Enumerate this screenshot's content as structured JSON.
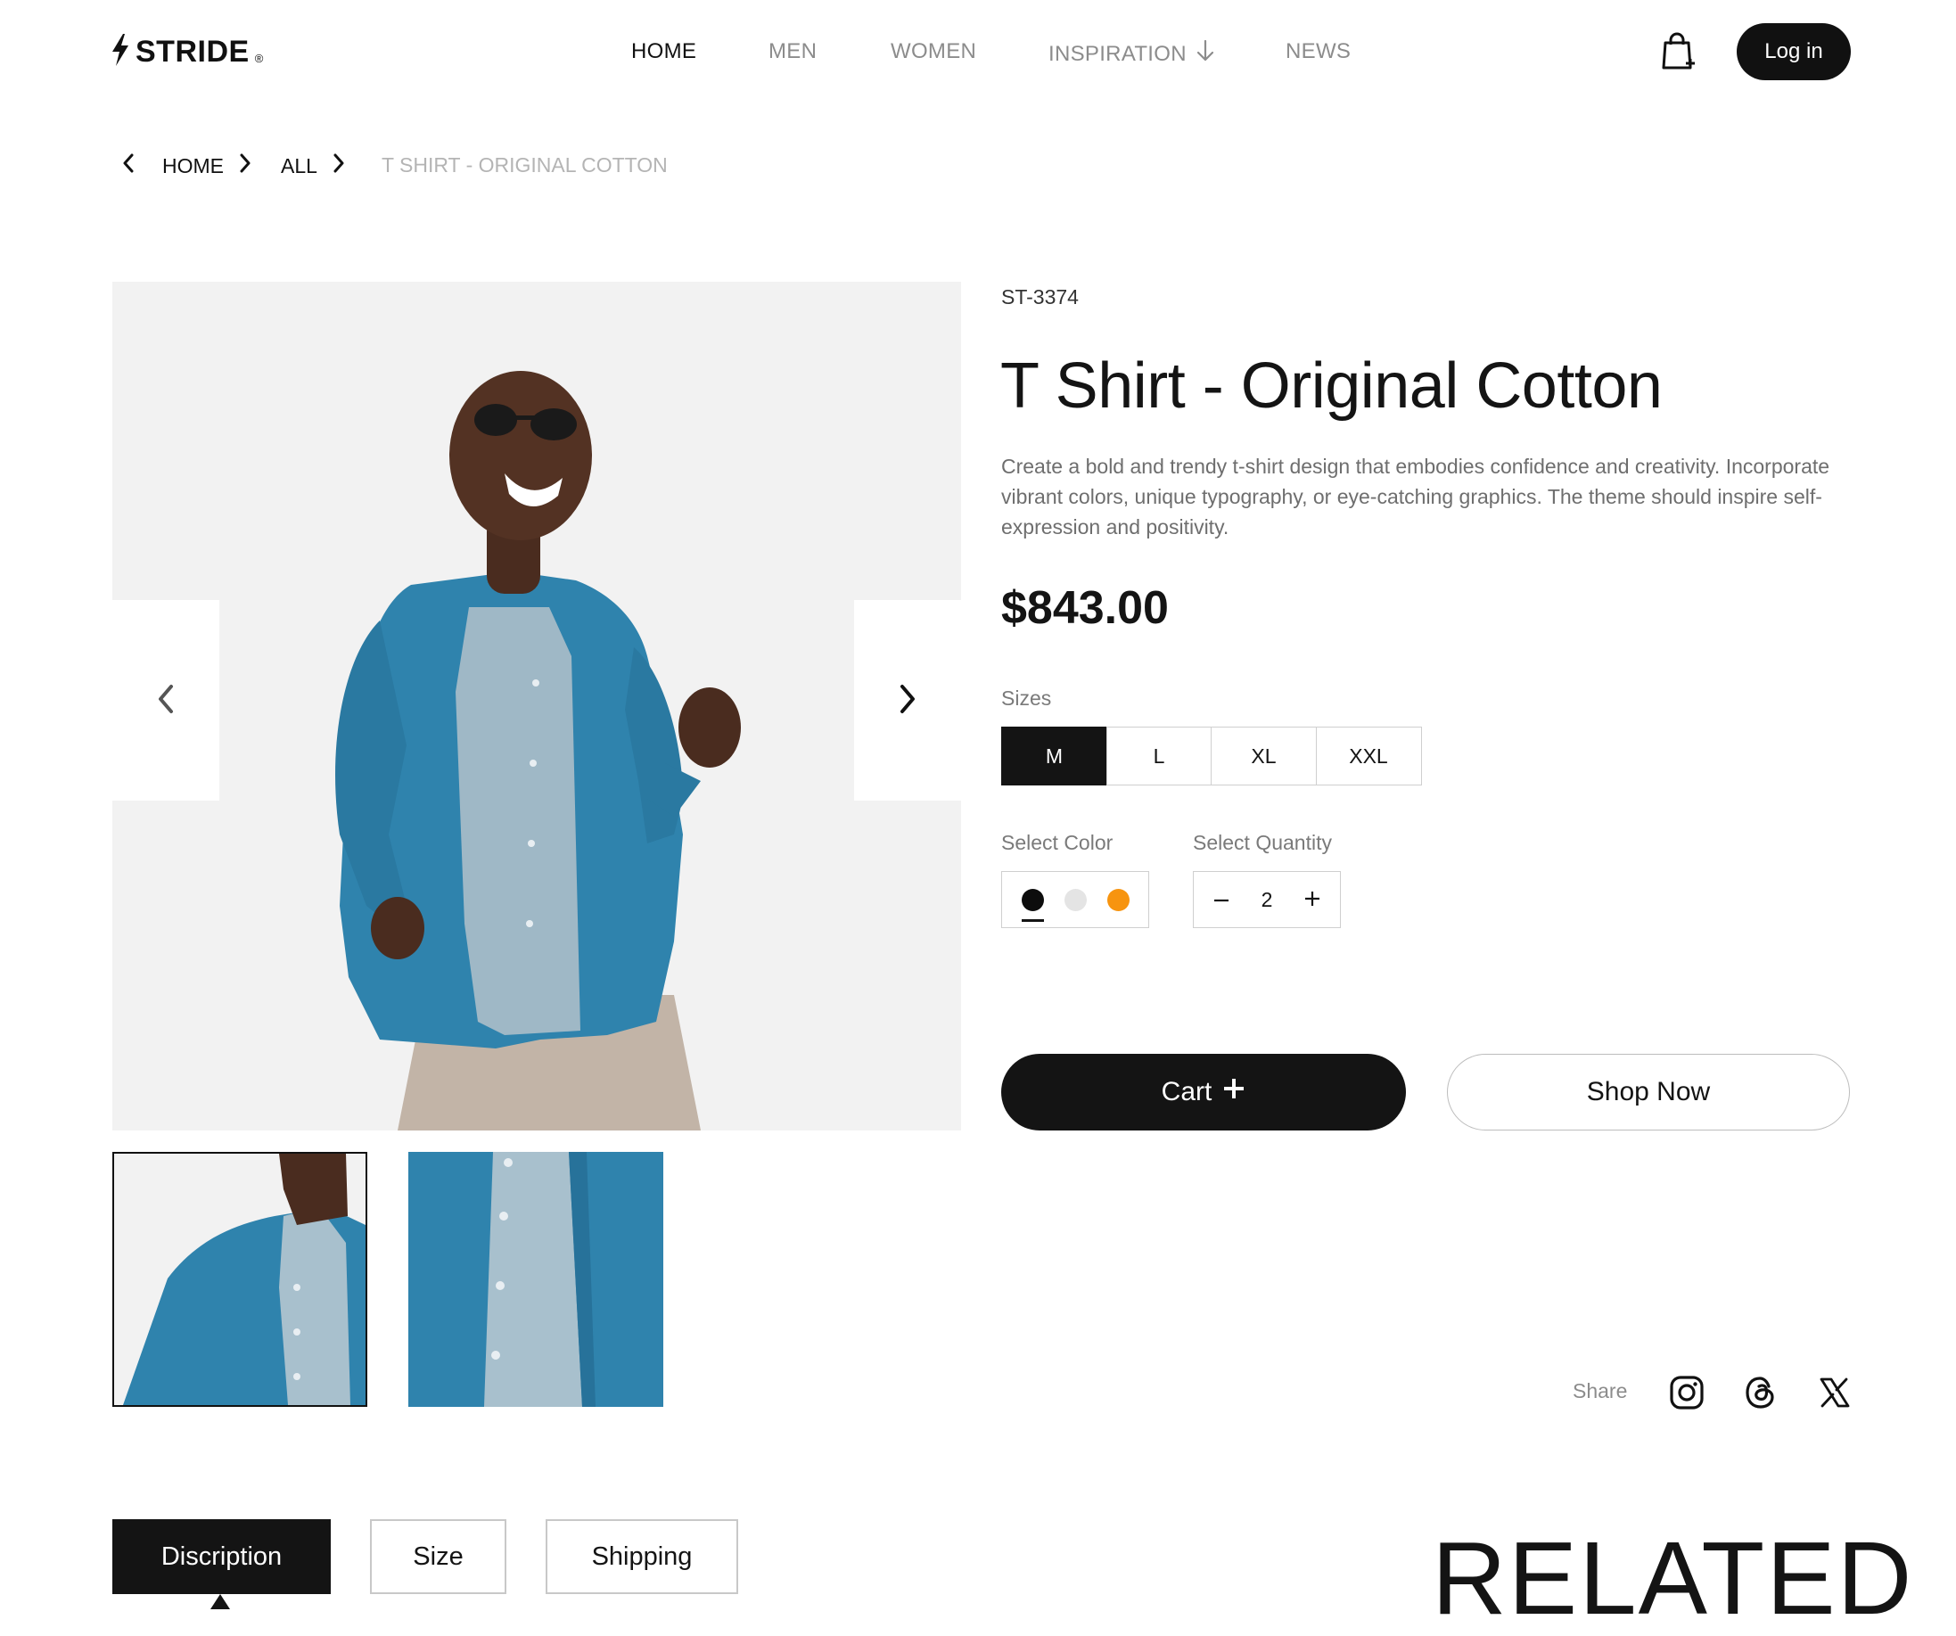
{
  "brand": {
    "name": "STRIDE",
    "mark": "®"
  },
  "nav": {
    "items": [
      {
        "label": "HOME",
        "active": true
      },
      {
        "label": "MEN"
      },
      {
        "label": "WOMEN"
      },
      {
        "label": "INSPIRATION"
      },
      {
        "label": "NEWS"
      }
    ],
    "login_label": "Log in"
  },
  "breadcrumb": {
    "items": [
      "HOME",
      "ALL"
    ],
    "current": "T SHIRT - ORIGINAL COTTON"
  },
  "product": {
    "sku": "ST-3374",
    "title": "T Shirt - Original Cotton",
    "description": "Create a bold and trendy t-shirt design that embodies confidence and creativity. Incorporate vibrant colors, unique typography, or eye-catching graphics. The theme should inspire self-expression and positivity.",
    "price": "$843.00",
    "sizes_label": "Sizes",
    "sizes": [
      "M",
      "L",
      "XL",
      "XXL"
    ],
    "selected_size": "M",
    "color_label": "Select Color",
    "colors": [
      "#0d0d0d",
      "#e4e4e4",
      "#f7940f"
    ],
    "selected_color": "#0d0d0d",
    "quantity_label": "Select Quantity",
    "quantity": "2",
    "cart_label": "Cart",
    "shop_label": "Shop Now",
    "share_label": "Share"
  },
  "tabs": [
    {
      "label": "Discription",
      "active": true
    },
    {
      "label": "Size"
    },
    {
      "label": "Shipping"
    }
  ],
  "related_heading": "RELATED",
  "icons": [
    "bolt-icon",
    "chevron-down-icon",
    "shopping-bag-icon",
    "chevron-left-icon",
    "chevron-right-icon",
    "plus-icon",
    "minus-icon",
    "instagram-icon",
    "threads-icon",
    "x-icon"
  ]
}
